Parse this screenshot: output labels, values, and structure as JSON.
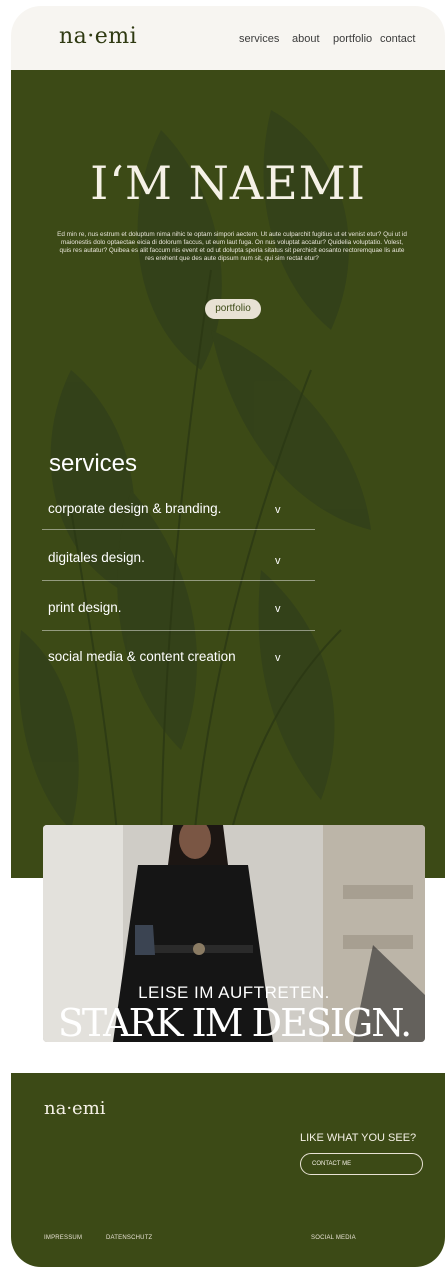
{
  "header": {
    "logo": "na·emi",
    "nav": [
      "services",
      "about",
      "portfolio",
      "contact"
    ]
  },
  "hero": {
    "title": "I‘M NAEMI",
    "text": "Ed min re, nus estrum et doluptum nima nihic te optam simpori aectem. Ut aute culparchit fugitius ut et venist etur? Qui ut id maionestis dolo optaectae eicia di dolorum faccus, ut eum laut fuga. On nus voluptat accatur? Quidelia voluptatio. Volest, quis res autatur? Quibea es alit faccum nis event et od ut dolupta speria sitatus sit perchicit eosanto rectoremquae lis aute res erehent que des aute dipsum num sit, qui sim rectat etur?",
    "button": "portfolio"
  },
  "services": {
    "title": "services",
    "items": [
      {
        "label": "corporate design & branding.",
        "chevron": "v"
      },
      {
        "label": "digitales design.",
        "chevron": "v"
      },
      {
        "label": "print design.",
        "chevron": "v"
      },
      {
        "label": "social media & content creation",
        "chevron": "v"
      }
    ]
  },
  "banner": {
    "line1": "LEISE IM AUFTRETEN.",
    "line2": "STARK IM DESIGN."
  },
  "footer": {
    "logo": "na·emi",
    "cta_title": "LIKE WHAT YOU SEE?",
    "cta_button": "CONTACT ME",
    "links": [
      "IMPRESSUM",
      "DATENSCHUTZ"
    ],
    "social": "SOCIAL MEDIA"
  },
  "colors": {
    "olive": "#3c4a16",
    "cream": "#f7f5f1",
    "beige": "#e8e2d4"
  }
}
